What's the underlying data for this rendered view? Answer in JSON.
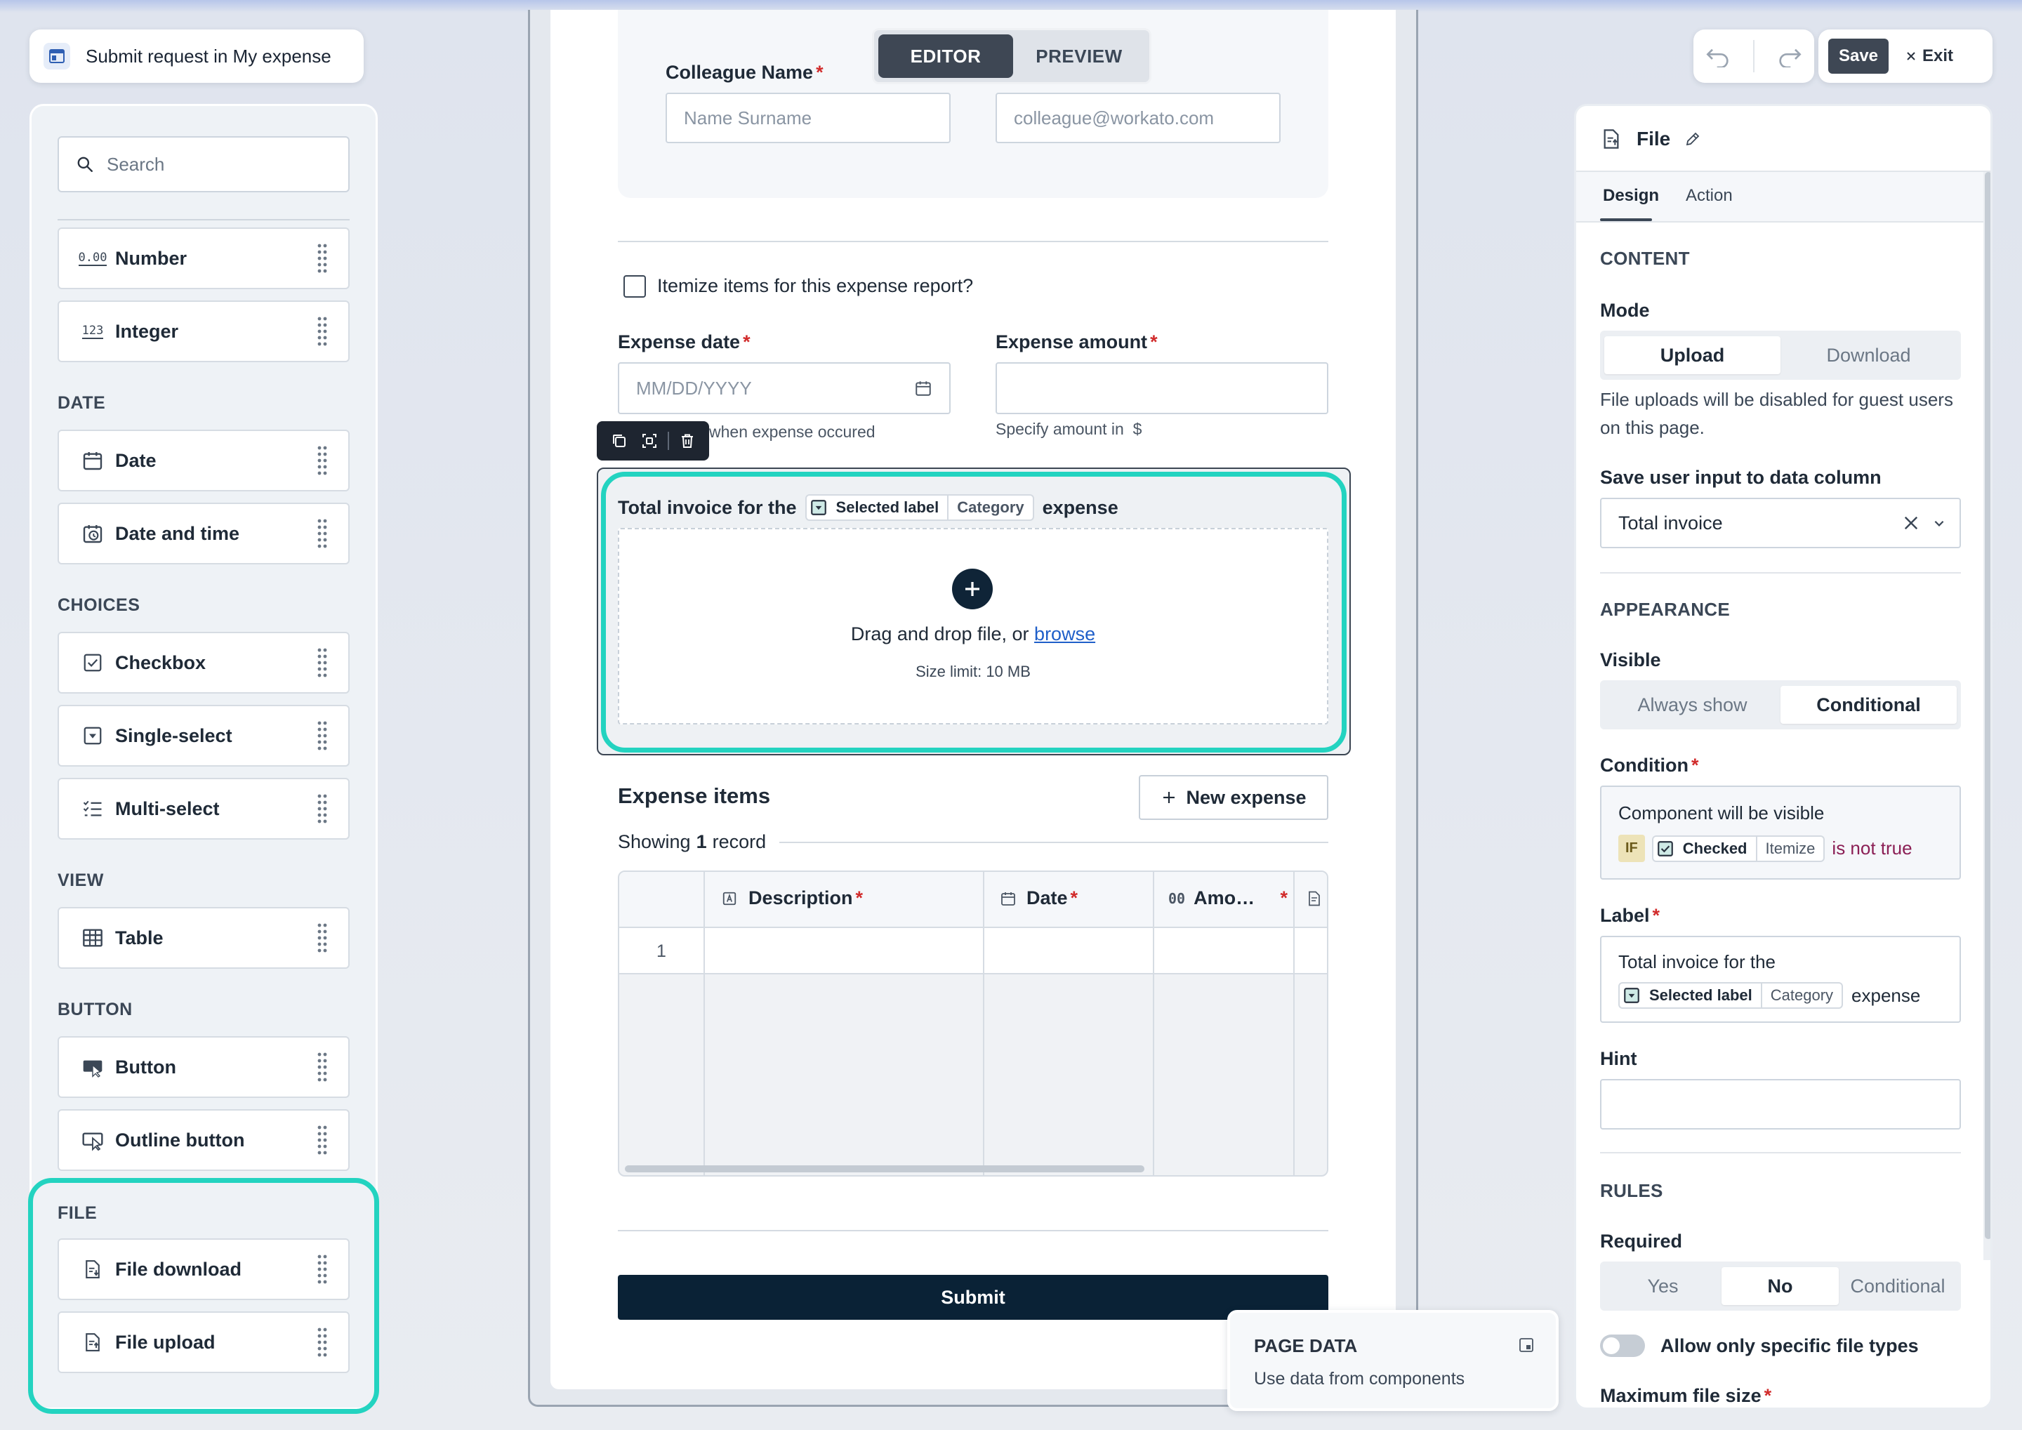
{
  "app": {
    "title": "Submit request in My expense"
  },
  "sidebar": {
    "search_placeholder": "Search",
    "sections": {
      "date": "DATE",
      "choices": "CHOICES",
      "view": "VIEW",
      "button": "BUTTON",
      "file": "FILE"
    },
    "items": {
      "number": "Number",
      "integer": "Integer",
      "date": "Date",
      "date_time": "Date and time",
      "checkbox": "Checkbox",
      "single_select": "Single-select",
      "multi_select": "Multi-select",
      "table": "Table",
      "button": "Button",
      "outline_button": "Outline button",
      "file_download": "File download",
      "file_upload": "File upload"
    },
    "number_icon_text": "0.00",
    "integer_icon_text": "123"
  },
  "mode_toggle": {
    "editor": "EDITOR",
    "preview": "PREVIEW"
  },
  "form": {
    "colleague_name_label": "Colleague Name",
    "name_placeholder": "Name Surname",
    "email_placeholder": "colleague@workato.com",
    "itemize_label": "Itemize items for this expense report?",
    "expense_date_label": "Expense date",
    "date_placeholder": "MM/DD/YYYY",
    "date_hint": "when expense occured",
    "expense_amount_label": "Expense amount",
    "amount_hint": "Specify amount in  $",
    "file_label_prefix": "Total invoice for the",
    "file_label_chip_main": "Selected label",
    "file_label_chip_sub": "Category",
    "file_label_suffix": "expense",
    "drop_text": "Drag and drop file, or",
    "browse_link": "browse",
    "size_limit": "Size limit: 10 MB",
    "expense_items_title": "Expense items",
    "new_expense": "New expense",
    "showing_prefix": "Showing",
    "showing_count": "1",
    "showing_suffix": "record",
    "columns": {
      "description": "Description",
      "date": "Date",
      "amount": "Amo…",
      "amount_icon_text": "00"
    },
    "row_number": "1",
    "submit": "Submit",
    "required_mark": "*"
  },
  "page_data": {
    "title": "PAGE DATA",
    "subtitle": "Use data from components"
  },
  "toolbar": {
    "save": "Save",
    "exit": "Exit"
  },
  "props": {
    "title": "File",
    "tabs": {
      "design": "Design",
      "action": "Action"
    },
    "content_heading": "CONTENT",
    "mode_label": "Mode",
    "mode_upload": "Upload",
    "mode_download": "Download",
    "mode_note": "File uploads will be disabled for guest users on this page.",
    "save_col_label": "Save user input to data column",
    "save_col_value": "Total invoice",
    "appearance_heading": "APPEARANCE",
    "visible_label": "Visible",
    "visible_always": "Always show",
    "visible_conditional": "Conditional",
    "condition_label": "Condition",
    "condition_text": "Component will be visible",
    "condition_if": "IF",
    "condition_chip_main": "Checked",
    "condition_chip_sub": "Itemize",
    "condition_op": "is not true",
    "label_label": "Label",
    "label_prefix": "Total invoice for the",
    "label_chip_main": "Selected label",
    "label_chip_sub": "Category",
    "label_suffix": "expense",
    "hint_label": "Hint",
    "rules_heading": "RULES",
    "required_label": "Required",
    "required_yes": "Yes",
    "required_no": "No",
    "required_conditional": "Conditional",
    "allow_types_label": "Allow only specific file types",
    "max_size_label": "Maximum file size"
  },
  "colors": {
    "accent_teal": "#23d3c0",
    "dark_navy": "#0a2236",
    "required_red": "#d12c2c",
    "link_blue": "#1f5fc9",
    "condition_purple": "#8b1f55"
  }
}
